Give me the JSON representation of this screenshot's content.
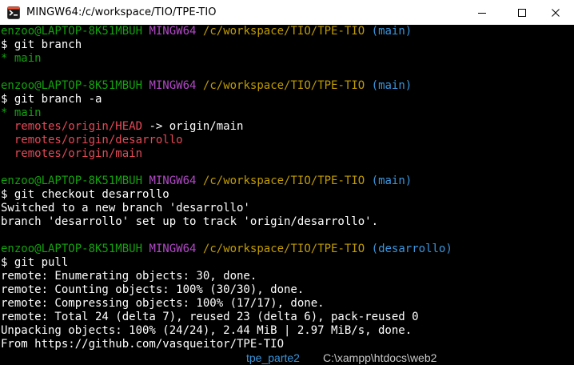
{
  "window": {
    "title": "MINGW64:/c/workspace/TIO/TPE-TIO",
    "icon": "git-bash-icon",
    "controls": [
      "minimize-icon",
      "maximize-icon",
      "close-icon"
    ]
  },
  "prompt": {
    "user_host": "enzoo@LAPTOP-8K51MBUH",
    "system": "MINGW64",
    "path": "/c/workspace/TIO/TPE-TIO",
    "dollar": "$ "
  },
  "blocks": [
    {
      "branch": "(main)",
      "command": "git branch",
      "output": [
        {
          "text": "* main",
          "color": "green"
        }
      ]
    },
    {
      "branch": "(main)",
      "command": "git branch -a",
      "output": [
        {
          "text": "* main",
          "color": "green"
        },
        {
          "text": "  remotes/origin/HEAD",
          "color": "red",
          "suffix": " -> origin/main"
        },
        {
          "text": "  remotes/origin/desarrollo",
          "color": "red"
        },
        {
          "text": "  remotes/origin/main",
          "color": "red"
        }
      ]
    },
    {
      "branch": "(main)",
      "command": "git checkout desarrollo",
      "output": [
        {
          "text": "Switched to a new branch 'desarrollo'",
          "color": "white"
        },
        {
          "text": "branch 'desarrollo' set up to track 'origin/desarrollo'.",
          "color": "white"
        }
      ]
    },
    {
      "branch": "(desarrollo)",
      "command": "git pull",
      "output": [
        {
          "text": "remote: Enumerating objects: 30, done.",
          "color": "white"
        },
        {
          "text": "remote: Counting objects: 100% (30/30), done.",
          "color": "white"
        },
        {
          "text": "remote: Compressing objects: 100% (17/17), done.",
          "color": "white"
        },
        {
          "text": "remote: Total 24 (delta 7), reused 23 (delta 6), pack-reused 0",
          "color": "white"
        },
        {
          "text": "Unpacking objects: 100% (24/24), 2.44 MiB | 2.97 MiB/s, done.",
          "color": "white"
        },
        {
          "text": "From https://github.com/vasqueitor/TPE-TIO",
          "color": "white"
        }
      ]
    }
  ],
  "statusbar": {
    "branch": "tpe_parte2",
    "path": "C:\\xampp\\htdocs\\web2"
  },
  "colors": {
    "background": "#000000",
    "user": "#13a10e",
    "system": "#b148c6",
    "path": "#c19c00",
    "branch": "#3a96dd",
    "remote": "#e74856"
  }
}
